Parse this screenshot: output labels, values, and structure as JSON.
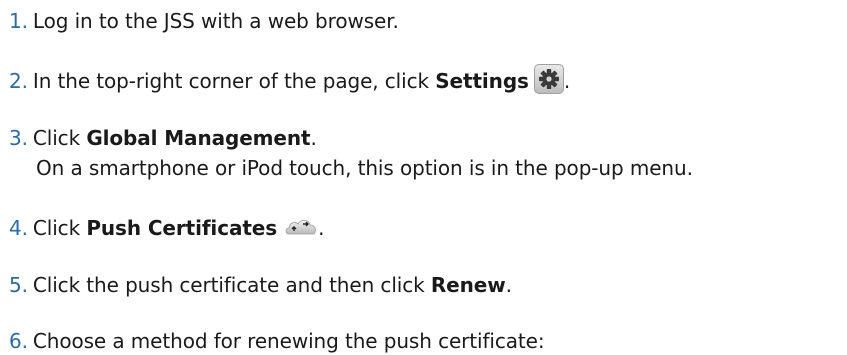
{
  "steps": [
    {
      "number": "1.",
      "text": "Log in to the JSS with a web browser."
    },
    {
      "number": "2.",
      "prefix": "In the top-right corner of the page, click ",
      "bold": "Settings",
      "suffix": ".",
      "icon": "gear-icon"
    },
    {
      "number": "3.",
      "prefix": "Click ",
      "bold": "Global Management",
      "suffix": ".",
      "note": "On a smartphone or iPod touch, this option is in the pop-up menu."
    },
    {
      "number": "4.",
      "prefix": "Click ",
      "bold": "Push Certificates",
      "suffix": ".",
      "icon": "cloud-sync-icon"
    },
    {
      "number": "5.",
      "prefix": "Click the push certificate and then click ",
      "bold": "Renew",
      "suffix": "."
    },
    {
      "number": "6.",
      "text": "Choose a method for renewing the push certificate:"
    }
  ],
  "colors": {
    "number": "#2b6aa8",
    "text": "#1a1a1a"
  }
}
